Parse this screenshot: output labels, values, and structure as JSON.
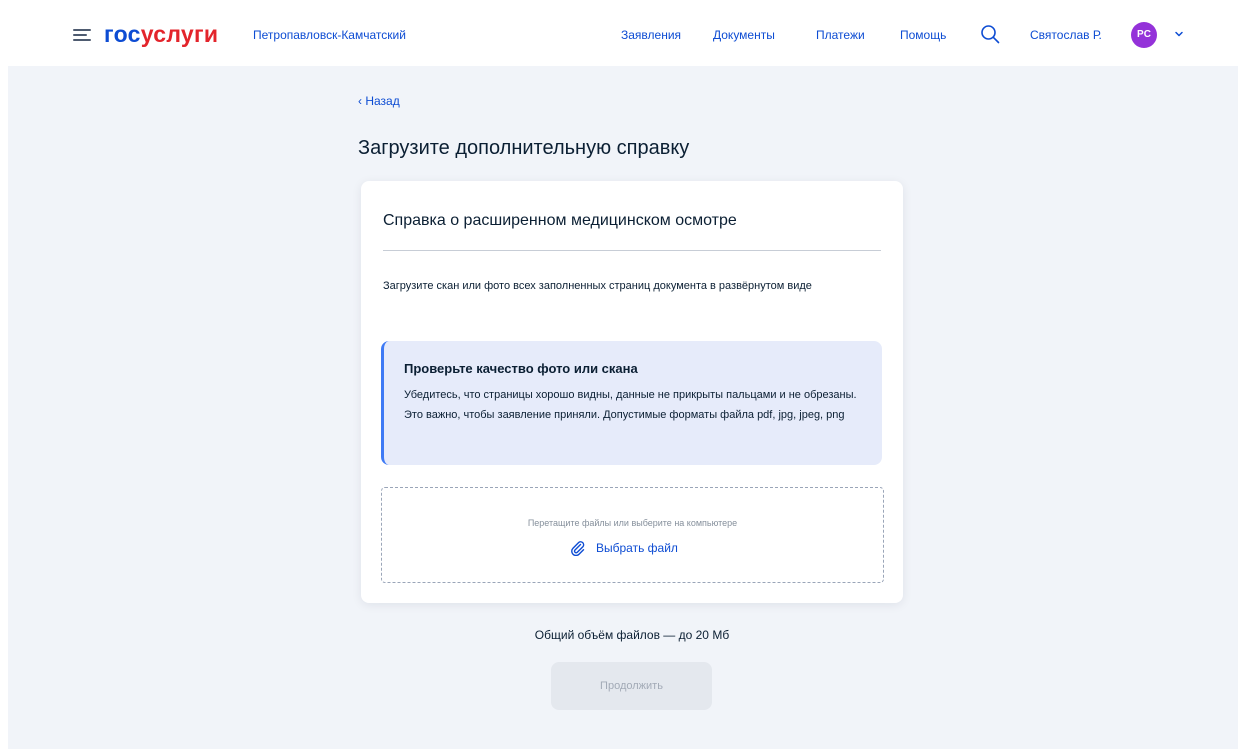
{
  "header": {
    "logo_part1": "гос",
    "logo_part2": "услуги",
    "city": "Петропавловск-Камчатский",
    "nav": [
      {
        "label": "Заявления"
      },
      {
        "label": "Документы"
      },
      {
        "label": "Платежи"
      },
      {
        "label": "Помощь"
      }
    ],
    "user_name": "Святослав Р.",
    "avatar_initials": "PC"
  },
  "main": {
    "back_label": "‹ Назад",
    "title": "Загрузите дополнительную справку",
    "card": {
      "title": "Справка о расширенном медицинском осмотре",
      "description": "Загрузите скан или фото всех заполненных страниц документа в развёрнутом виде",
      "info": {
        "title": "Проверьте качество фото или скана",
        "text": "Убедитесь, что страницы хорошо видны, данные не прикрыты пальцами и не обрезаны. Это важно, чтобы заявление приняли. Допустимые форматы файла pdf, jpg, jpeg, png"
      },
      "dropzone": {
        "hint": "Перетащите файлы или выберите на компьютере",
        "choose_label": "Выбрать файл"
      }
    },
    "size_limit": "Общий объём файлов — до 20 Мб",
    "continue_label": "Продолжить"
  },
  "colors": {
    "brand_blue": "#0d4cd3",
    "brand_red": "#e3242b",
    "avatar": "#9432d9",
    "info_bg": "#e6ebfa",
    "info_accent": "#3e7af5",
    "page_bg": "#f1f4f9"
  },
  "icons": {
    "menu": "menu-icon",
    "search": "search-icon",
    "chevron": "chevron-down-icon",
    "attach": "paperclip-icon"
  }
}
